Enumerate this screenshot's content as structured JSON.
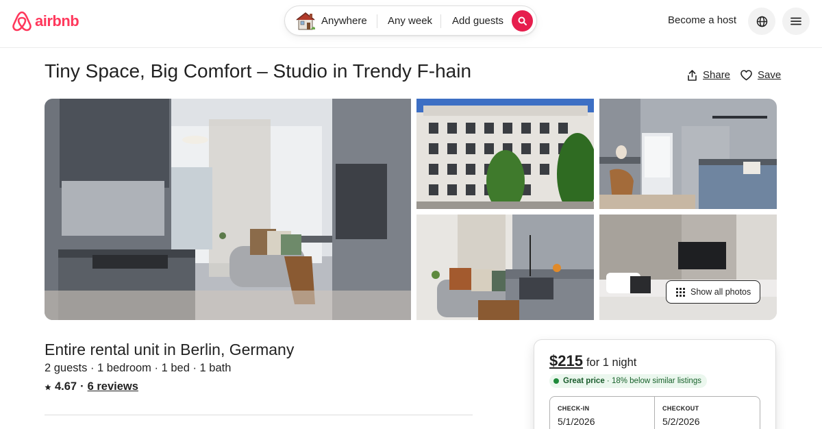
{
  "brand": {
    "name": "airbnb",
    "color": "#ff385c"
  },
  "search": {
    "icon": "house-icon",
    "anywhere": "Anywhere",
    "any_week": "Any week",
    "add_guests": "Add guests",
    "button_icon": "search-icon",
    "button_color": "#e61e4d"
  },
  "header_right": {
    "become_host": "Become a host",
    "language_icon": "globe-icon",
    "menu_icon": "hamburger-menu-icon"
  },
  "listing": {
    "title": "Tiny Space, Big Comfort – Studio in Trendy F-hain",
    "share_label": "Share",
    "save_label": "Save",
    "photos": [
      "living-kitchen-photo",
      "building-exterior-photo",
      "kitchen-photo",
      "living-area-photo",
      "bedroom-photo"
    ],
    "show_all_photos": "Show all photos",
    "type": "Entire rental unit in Berlin, Germany",
    "details": "2 guests · 1 bedroom · 1 bed · 1 bath",
    "rating": "4.67",
    "separator": "·",
    "reviews": "6 reviews"
  },
  "booking": {
    "price": "$215",
    "per_night": "for 1 night",
    "great_price_label": "Great price",
    "great_price_detail": " · 18% below similar listings",
    "checkin_label": "CHECK-IN",
    "checkin_value": "5/1/2026",
    "checkout_label": "CHECKOUT",
    "checkout_value": "5/2/2026"
  }
}
